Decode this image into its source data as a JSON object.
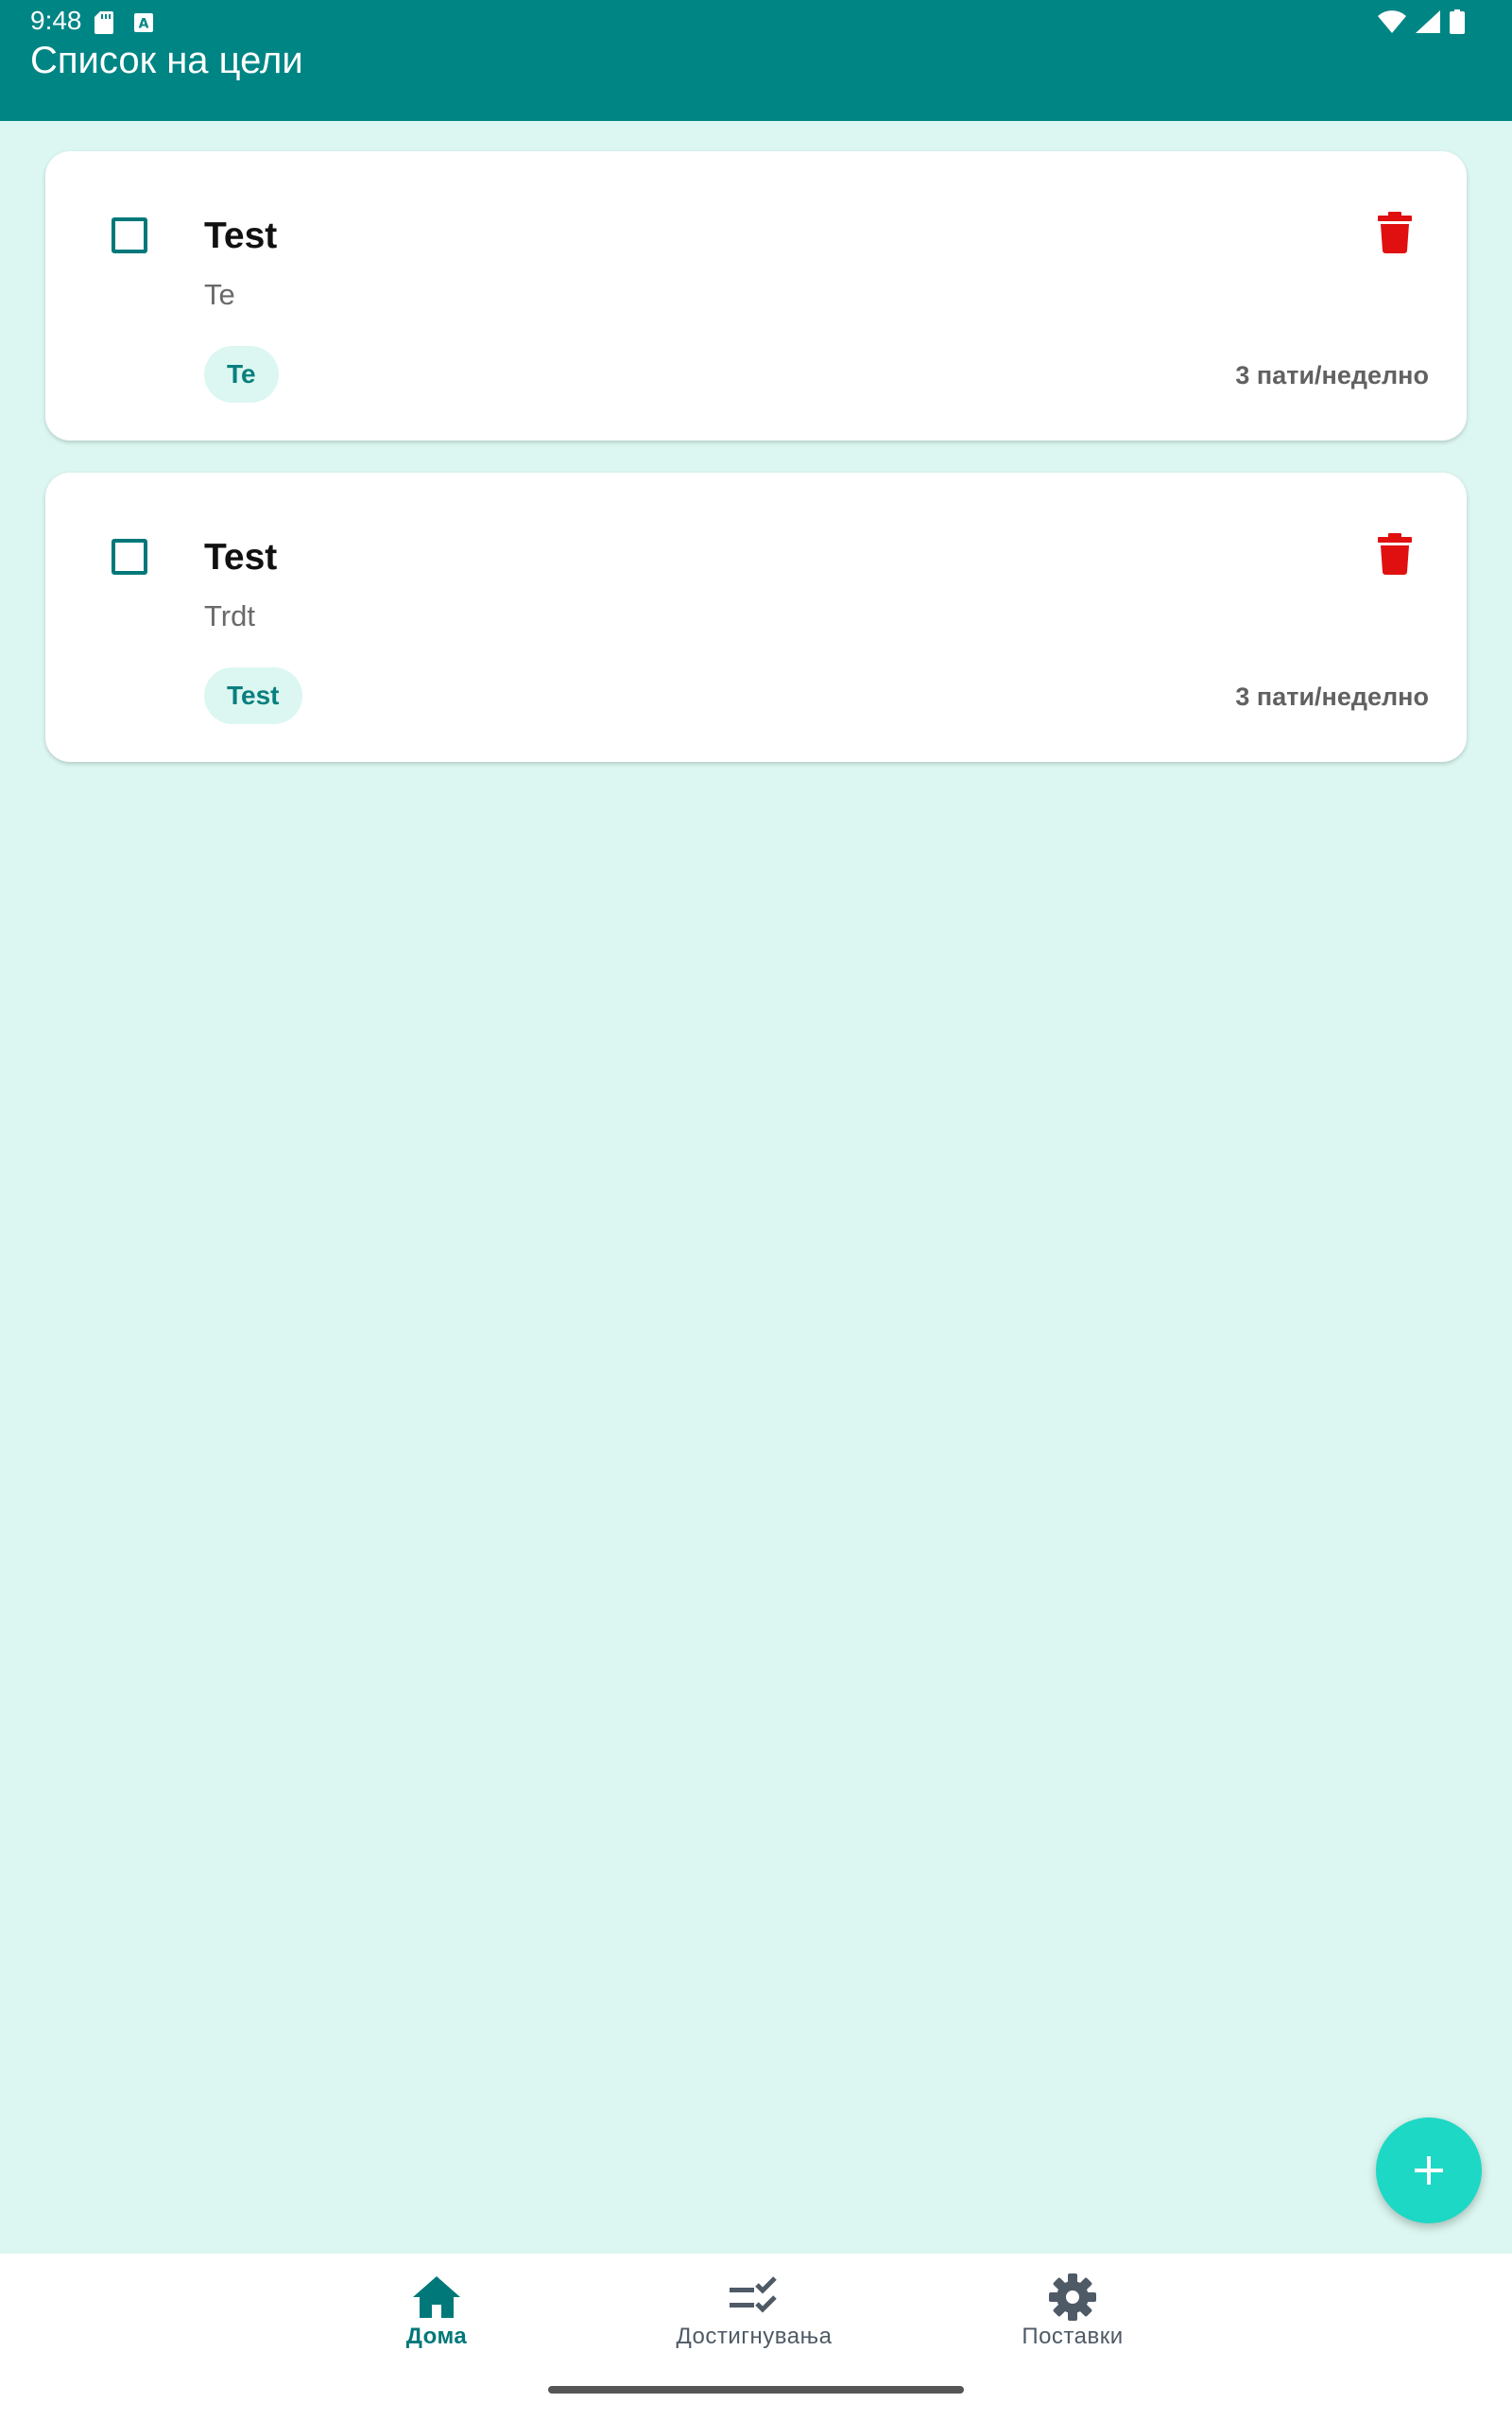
{
  "status_bar": {
    "time": "9:48",
    "left_icons": [
      "sd-card-icon",
      "keyboard-a-icon"
    ],
    "right_icons": [
      "wifi-icon",
      "signal-icon",
      "battery-icon"
    ]
  },
  "app_bar": {
    "title": "Список на цели"
  },
  "goals": [
    {
      "title": "Test",
      "description": "Te",
      "tag": "Te",
      "frequency": "3 пати/неделно",
      "checked": false
    },
    {
      "title": "Test",
      "description": "Trdt",
      "tag": "Test",
      "frequency": "3 пати/неделно",
      "checked": false
    }
  ],
  "fab": {
    "icon": "plus-icon"
  },
  "bottom_nav": {
    "items": [
      {
        "label": "Дома",
        "icon": "home-icon",
        "active": true
      },
      {
        "label": "Достигнувања",
        "icon": "checklist-icon",
        "active": false
      },
      {
        "label": "Поставки",
        "icon": "gear-icon",
        "active": false
      }
    ]
  },
  "colors": {
    "primary": "#008585",
    "background": "#dcf7f1",
    "accent_fab": "#1dd8c5",
    "delete": "#e01010",
    "tag_text": "#0a7f7f"
  }
}
